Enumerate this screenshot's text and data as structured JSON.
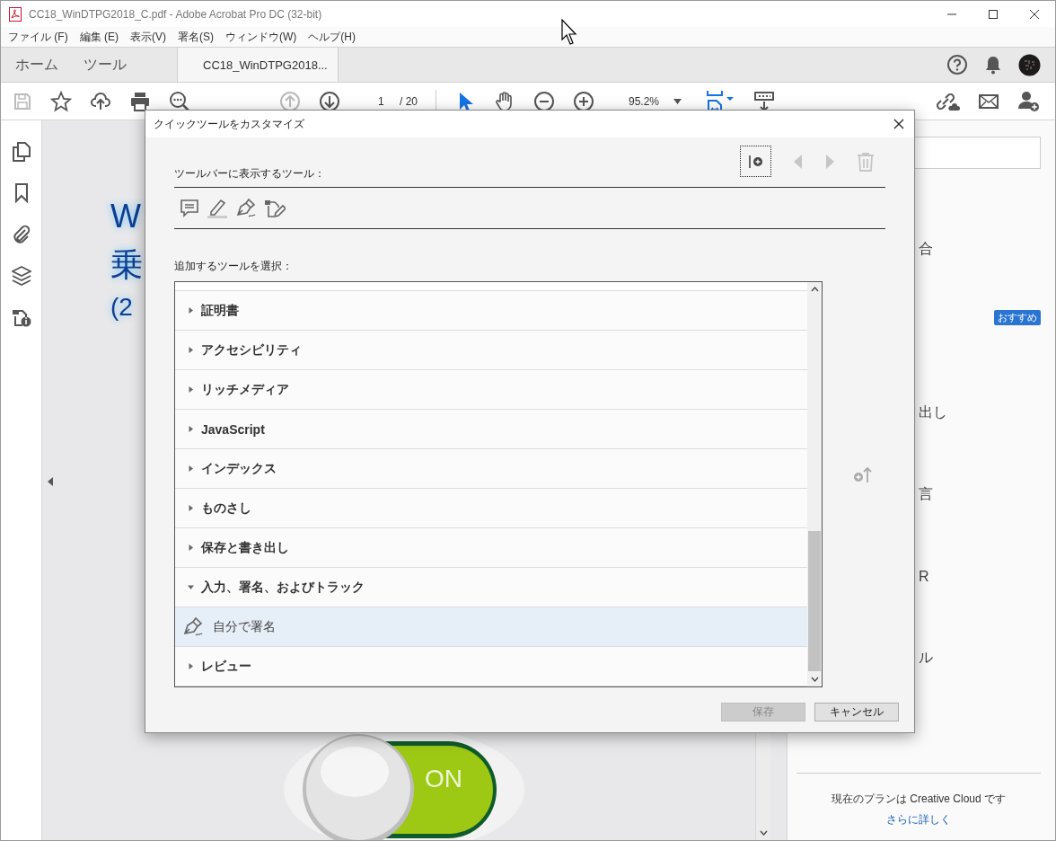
{
  "window": {
    "title": "CC18_WinDTPG2018_C.pdf - Adobe Acrobat Pro DC (32-bit)"
  },
  "menu": [
    "ファイル (F)",
    "編集 (E)",
    "表示(V)",
    "署名(S)",
    "ウィンドウ(W)",
    "ヘルプ(H)"
  ],
  "tabs": [
    {
      "label": "ホーム",
      "selected": false
    },
    {
      "label": "ツール",
      "selected": false
    },
    {
      "label": "CC18_WinDTPG2018...",
      "selected": true
    }
  ],
  "toolbar": {
    "page": "1",
    "page_total": "/ 20",
    "zoom": "95.2%"
  },
  "document": {
    "title_lines": [
      "W",
      "乗",
      "(2"
    ],
    "switch_label": "ON"
  },
  "right_panel": {
    "rows": [
      {
        "kind": "text",
        "text": "合"
      },
      {
        "kind": "badge",
        "text": "おすすめ"
      },
      {
        "kind": "text",
        "text": "出し"
      },
      {
        "kind": "text",
        "text": "言"
      },
      {
        "kind": "text",
        "text": "R"
      },
      {
        "kind": "text",
        "text": "ル"
      }
    ],
    "plan_text": "現在のプランは Creative Cloud です",
    "link": "さらに詳しく"
  },
  "dialog": {
    "title": "クイックツールをカスタマイズ",
    "toolbar_label": "ツールバーに表示するツール：",
    "select_label": "追加するツールを選択：",
    "categories": [
      {
        "label": "証明書",
        "expanded": false
      },
      {
        "label": "アクセシビリティ",
        "expanded": false
      },
      {
        "label": "リッチメディア",
        "expanded": false
      },
      {
        "label": "JavaScript",
        "expanded": false
      },
      {
        "label": "インデックス",
        "expanded": false
      },
      {
        "label": "ものさし",
        "expanded": false
      },
      {
        "label": "保存と書き出し",
        "expanded": false
      },
      {
        "label": "入力、署名、およびトラック",
        "expanded": true,
        "children": [
          {
            "label": "自分で署名",
            "selected": true
          }
        ]
      },
      {
        "label": "レビュー",
        "expanded": false
      }
    ],
    "buttons": [
      {
        "label": "保存",
        "disabled": true
      },
      {
        "label": "キャンセル",
        "disabled": false
      }
    ]
  }
}
